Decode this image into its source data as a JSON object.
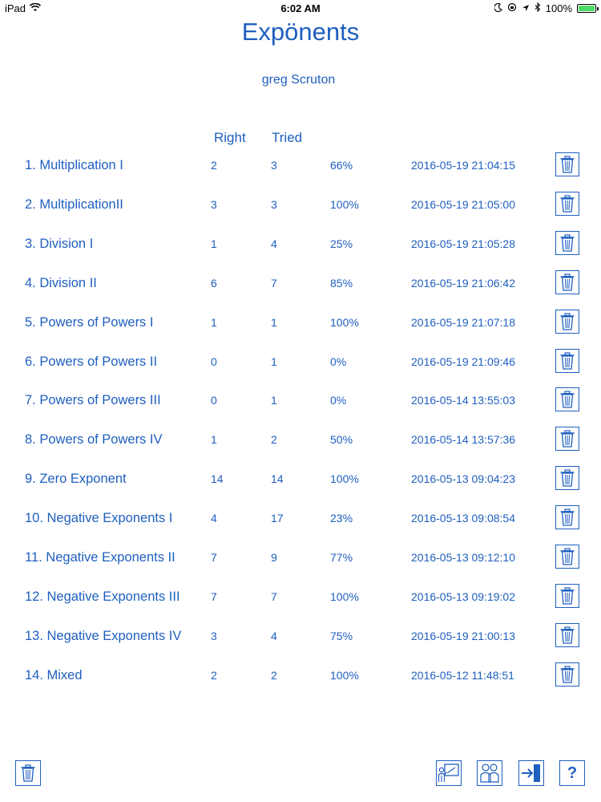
{
  "status_bar": {
    "device": "iPad",
    "time": "6:02 AM",
    "battery": "100%",
    "battery_level": 1.0
  },
  "app": {
    "title": "Expönents",
    "user": "greg Scruton"
  },
  "columns": {
    "right": "Right",
    "tried": "Tried"
  },
  "rows": [
    {
      "name": "1. Multiplication I",
      "right": "2",
      "tried": "3",
      "percent": "66%",
      "date": "2016-05-19 21:04:15"
    },
    {
      "name": "2. MultiplicationII",
      "right": "3",
      "tried": "3",
      "percent": "100%",
      "date": "2016-05-19 21:05:00"
    },
    {
      "name": "3. Division I",
      "right": "1",
      "tried": "4",
      "percent": "25%",
      "date": "2016-05-19 21:05:28"
    },
    {
      "name": "4. Division II",
      "right": "6",
      "tried": "7",
      "percent": "85%",
      "date": "2016-05-19 21:06:42"
    },
    {
      "name": "5. Powers of Powers I",
      "right": "1",
      "tried": "1",
      "percent": "100%",
      "date": "2016-05-19 21:07:18"
    },
    {
      "name": "6. Powers of Powers II",
      "right": "0",
      "tried": "1",
      "percent": "0%",
      "date": "2016-05-19 21:09:46"
    },
    {
      "name": "7. Powers of Powers III",
      "right": "0",
      "tried": "1",
      "percent": "0%",
      "date": "2016-05-14 13:55:03"
    },
    {
      "name": "8. Powers of Powers IV",
      "right": "1",
      "tried": "2",
      "percent": "50%",
      "date": "2016-05-14 13:57:36"
    },
    {
      "name": "9. Zero Exponent",
      "right": "14",
      "tried": "14",
      "percent": "100%",
      "date": "2016-05-13 09:04:23"
    },
    {
      "name": "10. Negative Exponents I",
      "right": "4",
      "tried": "17",
      "percent": "23%",
      "date": "2016-05-13 09:08:54"
    },
    {
      "name": "11. Negative Exponents II",
      "right": "7",
      "tried": "9",
      "percent": "77%",
      "date": "2016-05-13 09:12:10"
    },
    {
      "name": "12. Negative Exponents III",
      "right": "7",
      "tried": "7",
      "percent": "100%",
      "date": "2016-05-13 09:19:02"
    },
    {
      "name": "13. Negative Exponents IV",
      "right": "3",
      "tried": "4",
      "percent": "75%",
      "date": "2016-05-19 21:00:13"
    },
    {
      "name": "14. Mixed",
      "right": "2",
      "tried": "2",
      "percent": "100%",
      "date": "2016-05-12 11:48:51"
    }
  ],
  "toolbar": {
    "help_label": "?",
    "icons": [
      "trash-icon",
      "teacher-board-icon",
      "students-icon",
      "exit-door-icon",
      "help-icon"
    ]
  },
  "colors": {
    "accent": "#1f5fbf",
    "background": "#ffffff"
  }
}
